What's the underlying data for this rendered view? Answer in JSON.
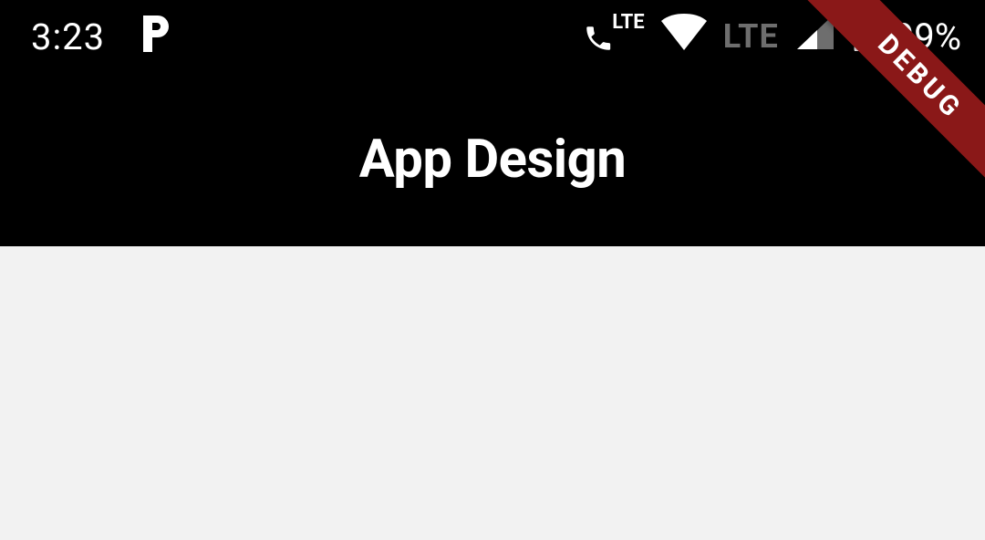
{
  "status_bar": {
    "time": "3:23",
    "phone_lte_label": "LTE",
    "lte2_label": "LTE",
    "battery_pct": "99%"
  },
  "header": {
    "title": "App Design"
  },
  "debug_banner": {
    "label": "DEBUG"
  }
}
